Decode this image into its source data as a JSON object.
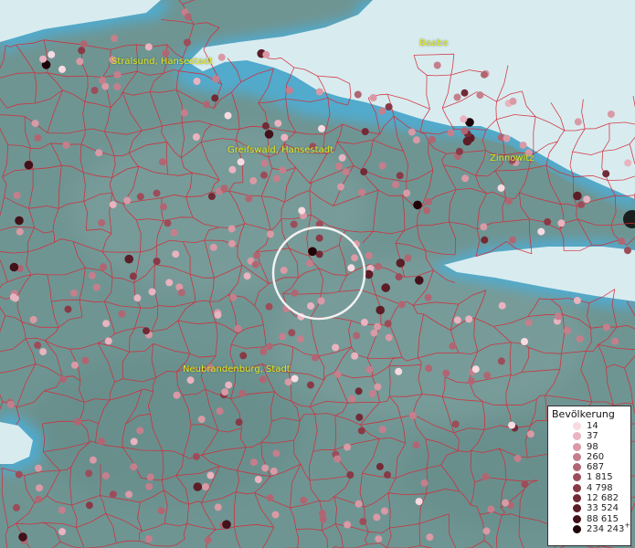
{
  "map": {
    "labels": [
      {
        "id": "stralsund",
        "text": "Stralsund, Hansestadt"
      },
      {
        "id": "baabe",
        "text": "Baabe"
      },
      {
        "id": "greifswald",
        "text": "Greifswald, Hansestadt"
      },
      {
        "id": "zinnowitz",
        "text": "Zinnowitz"
      },
      {
        "id": "neubrandenburg",
        "text": "Neubrandenburg, Stadt"
      }
    ]
  },
  "legend": {
    "title": "Bevölkerung",
    "classes": [
      {
        "label": "14",
        "color": "#f7dbe1"
      },
      {
        "label": "37",
        "color": "#e9b3bf"
      },
      {
        "label": "98",
        "color": "#d99aa6"
      },
      {
        "label": "260",
        "color": "#c57f8c"
      },
      {
        "label": "687",
        "color": "#b06672"
      },
      {
        "label": "1 815",
        "color": "#9c4d5a"
      },
      {
        "label": "4 798",
        "color": "#883a46"
      },
      {
        "label": "12 682",
        "color": "#722b36"
      },
      {
        "label": "33 524",
        "color": "#5c1d27"
      },
      {
        "label": "88 615",
        "color": "#42111a"
      },
      {
        "label": "234 243",
        "color": "#1d0509",
        "plus": "+"
      }
    ]
  },
  "colors": {
    "land": "#6f9593",
    "water": "#d8ecf0",
    "coast": "#4eaed6",
    "borders": "#d42a36",
    "label": "#e3e81a"
  }
}
